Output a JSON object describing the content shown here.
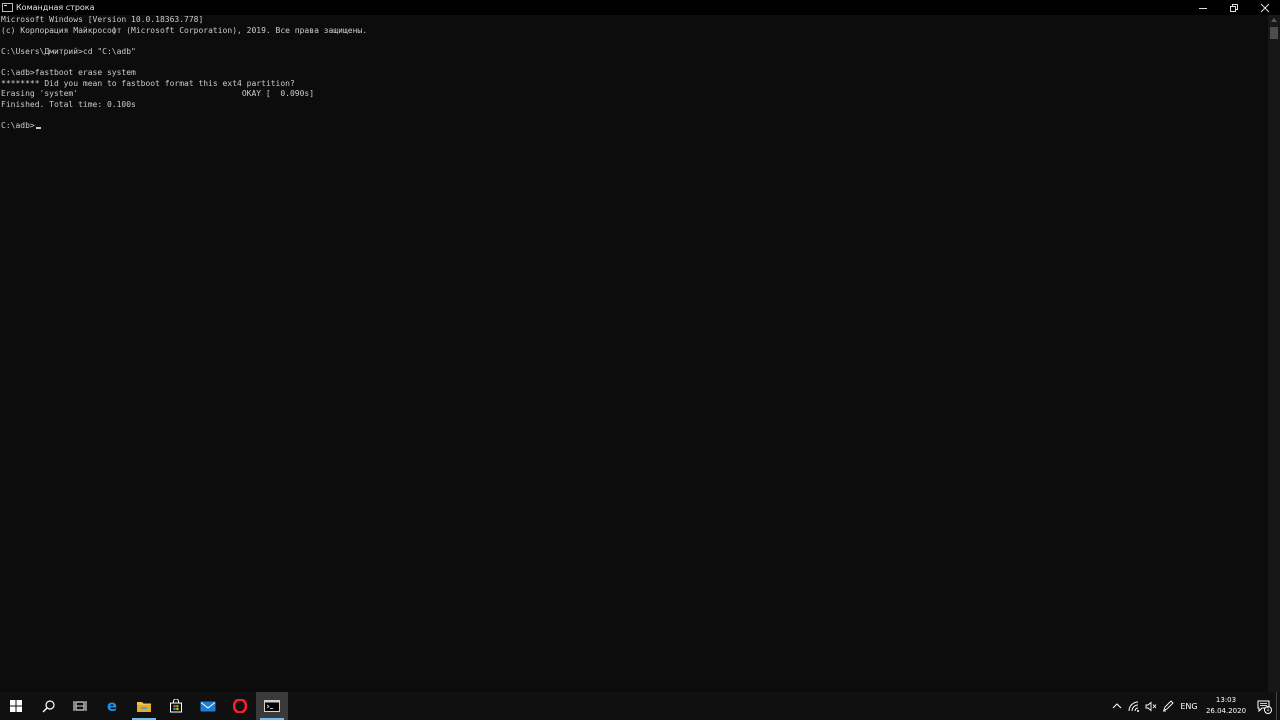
{
  "window": {
    "title": "Командная строка",
    "controls": [
      "minimize-icon",
      "restore-icon",
      "close-icon"
    ]
  },
  "console": {
    "lines": [
      "Microsoft Windows [Version 10.0.18363.778]",
      "(c) Корпорация Майкрософт (Microsoft Corporation), 2019. Все права защищены.",
      "",
      "C:\\Users\\Дмитрий>cd \"C:\\adb\"",
      "",
      "C:\\adb>fastboot erase system",
      "******** Did you mean to fastboot format this ext4 partition?",
      "Erasing 'system'                                  OKAY [  0.090s]",
      "Finished. Total time: 0.100s",
      ""
    ],
    "prompt": "C:\\adb>"
  },
  "taskbar": {
    "apps": [
      {
        "name": "start-icon"
      },
      {
        "name": "search-icon"
      },
      {
        "name": "task-view-icon"
      },
      {
        "name": "edge-icon"
      },
      {
        "name": "file-explorer-icon"
      },
      {
        "name": "store-icon"
      },
      {
        "name": "mail-icon"
      },
      {
        "name": "opera-icon"
      },
      {
        "name": "command-prompt-icon"
      }
    ],
    "tray": {
      "language": "ENG",
      "time": "13:03",
      "date": "26.04.2020",
      "notification_count": "1"
    }
  },
  "colors": {
    "console_bg": "#0c0c0c",
    "console_fg": "#cccccc",
    "taskbar_bg": "#101010",
    "accent": "#76b9ed"
  }
}
